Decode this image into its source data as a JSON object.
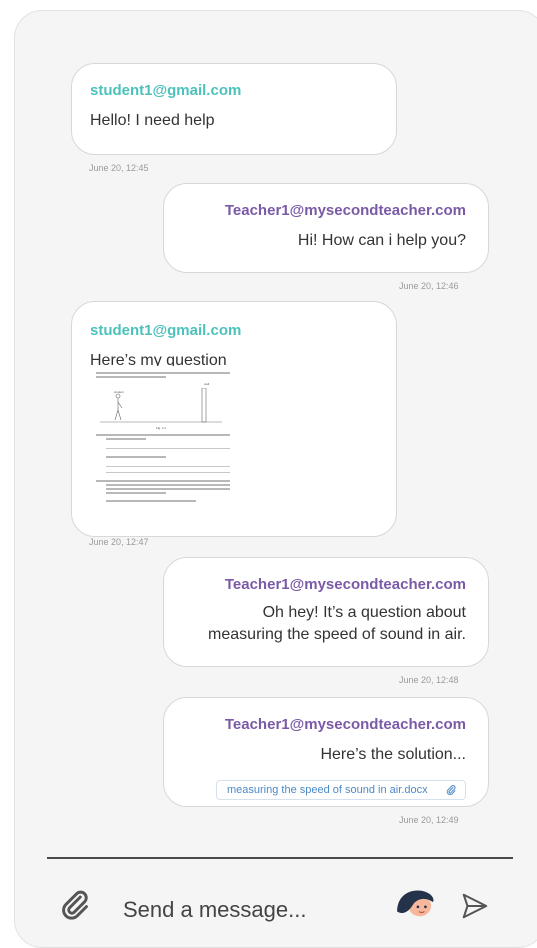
{
  "messages": [
    {
      "sender": "student1@gmail.com",
      "text": "Hello! I need help",
      "time": "June 20, 12:45"
    },
    {
      "sender": "Teacher1@mysecondteacher.com",
      "text": "Hi! How can i help you?",
      "time": "June 20, 12:46"
    },
    {
      "sender": "student1@gmail.com",
      "text": "Here’s my question",
      "time": "June 20, 12:47"
    },
    {
      "sender": "Teacher1@mysecondteacher.com",
      "text_line1": "Oh hey! It’s a question about",
      "text_line2": "measuring the speed of sound in air.",
      "time": "June 20, 12:48"
    },
    {
      "sender": "Teacher1@mysecondteacher.com",
      "text": "Here’s the solution...",
      "attachment": "measuring the speed of sound in air.docx",
      "time": "June 20, 12:49"
    }
  ],
  "worksheet": {
    "fig_label": "Fig. 4.1",
    "label_student": "student",
    "label_wall": "wall"
  },
  "composer": {
    "placeholder": "Send a message..."
  },
  "icons": {
    "attach": "paperclip-icon",
    "avatar": "avatar-icon",
    "send": "send-icon",
    "attachment_clip": "paperclip-small-icon"
  },
  "colors": {
    "student": "#4cc2bb",
    "teacher": "#7a5aa6",
    "attachment_text": "#4a8ac7",
    "panel_bg": "#f5f5f5"
  }
}
